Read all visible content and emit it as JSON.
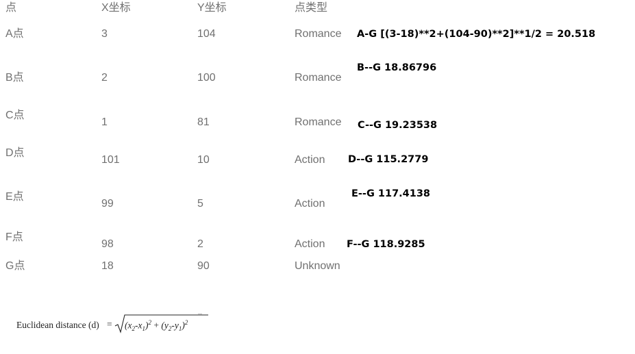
{
  "headers": {
    "point": "点",
    "x": "X坐标",
    "y": "Y坐标",
    "type": "点类型"
  },
  "rows": [
    {
      "point": "A点",
      "x": "3",
      "y": "104",
      "type": "Romance"
    },
    {
      "point": "B点",
      "x": "2",
      "y": "100",
      "type": "Romance"
    },
    {
      "point": "C点",
      "x": "1",
      "y": "81",
      "type": "Romance"
    },
    {
      "point": "D点",
      "x": "101",
      "y": "10",
      "type": "Action"
    },
    {
      "point": "E点",
      "x": "99",
      "y": "5",
      "type": "Action"
    },
    {
      "point": "F点",
      "x": "98",
      "y": "2",
      "type": "Action"
    },
    {
      "point": "G点",
      "x": "18",
      "y": "90",
      "type": "Unknown"
    }
  ],
  "distances": [
    "A-G [(3-18)**2+(104-90)**2]**1/2 = 20.518",
    "B--G   18.86796",
    "C--G  19.23538",
    "D--G  115.2779",
    "E--G  117.4138",
    "F--G   118.9285"
  ],
  "formula": {
    "label": "Euclidean distance (d)",
    "equals": "=",
    "open1": "(x",
    "sub2a": "2",
    "dash1": "-x",
    "sub1a": "1",
    "close1": ")",
    "sq1": "2",
    "plus": " + ",
    "open2": "(y",
    "sub2b": "2",
    "dash2": "-y",
    "sub1b": "1",
    "close2": ")",
    "sq2": "2"
  }
}
